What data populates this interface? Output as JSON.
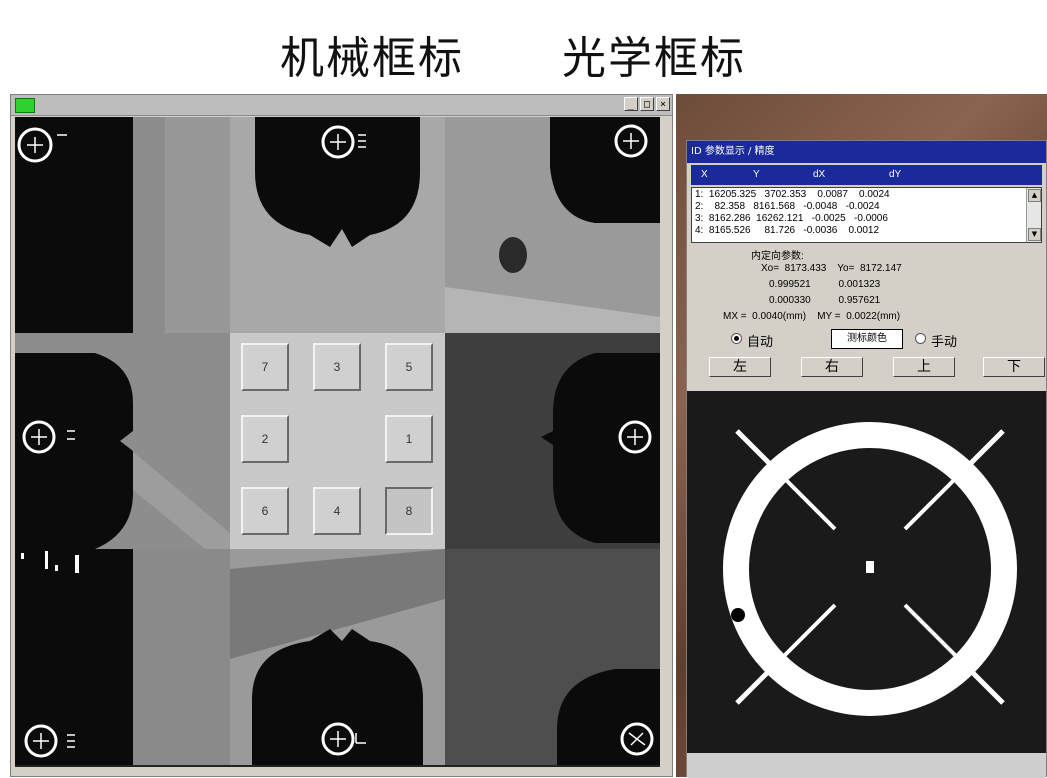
{
  "header": {
    "left_title": "机械框标",
    "right_title": "光学框标"
  },
  "left_window": {
    "controls": [
      "_",
      "□",
      "×"
    ],
    "keypad": {
      "keys": [
        "7",
        "3",
        "5",
        "2",
        "1",
        "6",
        "4",
        "8"
      ],
      "pressed": "8"
    },
    "icons": [
      "fiducial-crosshair-icon"
    ]
  },
  "right_window": {
    "title": "ID 参数显示 / 精度",
    "list_headers": [
      "X",
      "Y",
      "dX",
      "dY"
    ],
    "rows": [
      "1:  16205.325   3702.353    0.0087    0.0024",
      "2:    82.358   8161.568   -0.0048   -0.0024",
      "3:  8162.286  16262.121   -0.0025   -0.0006",
      "4:  8165.526     81.726   -0.0036    0.0012"
    ],
    "params_title": "内定向参数:",
    "params": [
      "Xo=  8173.433    Yo=  8172.147",
      "0.999521          0.001323",
      "0.000330          0.957621",
      "MX =  0.0040(mm)    MY =  0.0022(mm)"
    ],
    "auto_label": "自动",
    "color_button": "测标颜色",
    "manual_label": "手动",
    "direction_buttons": [
      "左",
      "右",
      "上",
      "下"
    ]
  },
  "colors": {
    "titlebar_blue": "#1b2a9b",
    "window_gray": "#d4d0c8",
    "status_green": "#2fd12f"
  }
}
